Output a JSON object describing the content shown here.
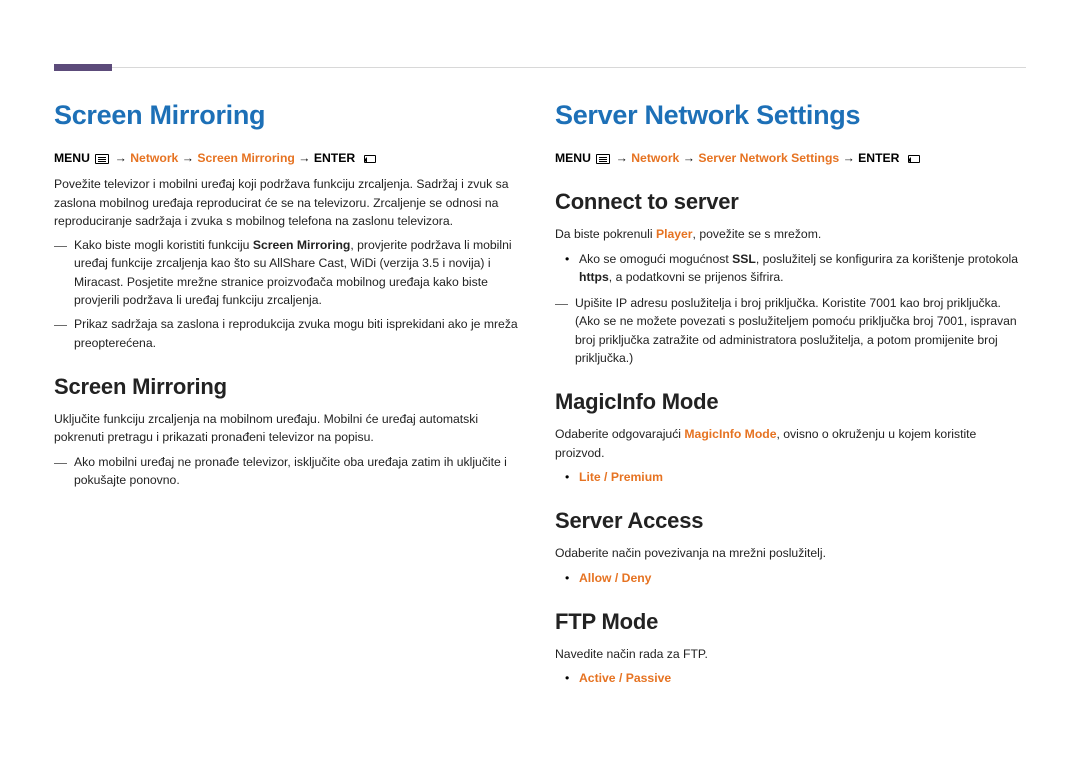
{
  "left": {
    "h1": "Screen Mirroring",
    "menu_prefix": "MENU",
    "menu_arrow": "→",
    "menu_network": "Network",
    "menu_item": "Screen Mirroring",
    "menu_enter": "ENTER",
    "intro": "Povežite televizor i mobilni uređaj koji podržava funkciju zrcaljenja. Sadržaj i zvuk sa zaslona mobilnog uređaja reproducirat će se na televizoru. Zrcaljenje se odnosi na reproduciranje sadržaja i zvuka s mobilnog telefona na zaslonu televizora.",
    "note1_a": "Kako biste mogli koristiti funkciju ",
    "note1_bold": "Screen Mirroring",
    "note1_b": ", provjerite podržava li mobilni uređaj funkcije zrcaljenja kao što su AllShare Cast, WiDi (verzija 3.5 i novija) i Miracast. Posjetite mrežne stranice proizvođača mobilnog uređaja kako biste provjerili podržava li uređaj funkciju zrcaljenja.",
    "note2": "Prikaz sadržaja sa zaslona i reprodukcija zvuka mogu biti isprekidani ako je mreža preopterećena.",
    "h2": "Screen Mirroring",
    "sub_intro": "Uključite funkciju zrcaljenja na mobilnom uređaju. Mobilni će uređaj automatski pokrenuti pretragu i prikazati pronađeni televizor na popisu.",
    "sub_note": "Ako mobilni uređaj ne pronađe televizor, isključite oba uređaja zatim ih uključite i pokušajte ponovno."
  },
  "right": {
    "h1": "Server Network Settings",
    "menu_prefix": "MENU",
    "menu_arrow": "→",
    "menu_network": "Network",
    "menu_item": "Server Network Settings",
    "menu_enter": "ENTER",
    "connect": {
      "h2": "Connect to server",
      "intro_a": "Da biste pokrenuli ",
      "intro_bold": "Player",
      "intro_b": ", povežite se s mrežom.",
      "bullet_a": "Ako se omogući mogućnost ",
      "bullet_bold1": "SSL",
      "bullet_b": ", poslužitelj se konfigurira za korištenje protokola ",
      "bullet_bold2": "https",
      "bullet_c": ", a podatkovni se prijenos šifrira.",
      "note": "Upišite IP adresu poslužitelja i broj priključka. Koristite 7001 kao broj priključka. (Ako se ne možete povezati s poslužiteljem pomoću priključka broj 7001, ispravan broj priključka zatražite od administratora poslužitelja, a potom promijenite broj priključka.)"
    },
    "magic": {
      "h2": "MagicInfo Mode",
      "intro_a": "Odaberite odgovarajući ",
      "intro_bold": "MagicInfo Mode",
      "intro_b": ", ovisno o okruženju u kojem koristite proizvod.",
      "option": "Lite / Premium"
    },
    "access": {
      "h2": "Server Access",
      "intro": "Odaberite način povezivanja na mrežni poslužitelj.",
      "option": "Allow / Deny"
    },
    "ftp": {
      "h2": "FTP Mode",
      "intro": "Navedite način rada za FTP.",
      "option": "Active / Passive"
    }
  }
}
